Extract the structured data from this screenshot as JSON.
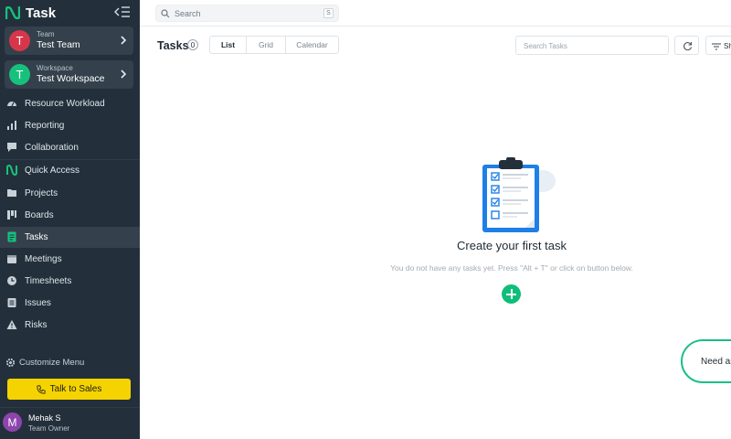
{
  "app": {
    "brand": "Task"
  },
  "sidebar": {
    "team": {
      "caption": "Team",
      "name": "Test Team",
      "initial": "T",
      "color": "#d7364a"
    },
    "workspace": {
      "caption": "Workspace",
      "name": "Test Workspace",
      "initial": "T",
      "color": "#17c17d"
    },
    "items": [
      {
        "label": "Resource Workload",
        "icon": "workload-icon"
      },
      {
        "label": "Reporting",
        "icon": "reporting-icon"
      },
      {
        "label": "Collaboration",
        "icon": "chat-icon"
      },
      {
        "label": "Quick Access",
        "icon": "quick-access-icon"
      },
      {
        "label": "Projects",
        "icon": "folder-icon"
      },
      {
        "label": "Boards",
        "icon": "boards-icon"
      },
      {
        "label": "Tasks",
        "icon": "tasks-icon",
        "active": true
      },
      {
        "label": "Meetings",
        "icon": "calendar-icon"
      },
      {
        "label": "Timesheets",
        "icon": "clock-icon"
      },
      {
        "label": "Issues",
        "icon": "issues-icon"
      },
      {
        "label": "Risks",
        "icon": "warning-icon"
      }
    ],
    "customize_label": "Customize Menu",
    "sales_button": "Talk to Sales",
    "user": {
      "initial": "M",
      "name": "Mehak S",
      "role": "Team Owner"
    }
  },
  "topbar": {
    "search_placeholder": "Search",
    "search_shortcut": "S"
  },
  "toolbar": {
    "title": "Tasks",
    "count": "0",
    "views": [
      "List",
      "Grid",
      "Calendar"
    ],
    "selected_view": "List",
    "search_tasks_placeholder": "Search Tasks",
    "filter_label": "Sh"
  },
  "empty_state": {
    "title": "Create your first task",
    "subtitle": "You do not have any tasks yet. Press \"Alt + T\" or click on button below."
  },
  "help": {
    "label": "Need as"
  },
  "colors": {
    "sidebar": "#23303b",
    "accent": "#0fbd79",
    "sales": "#f5d300"
  }
}
